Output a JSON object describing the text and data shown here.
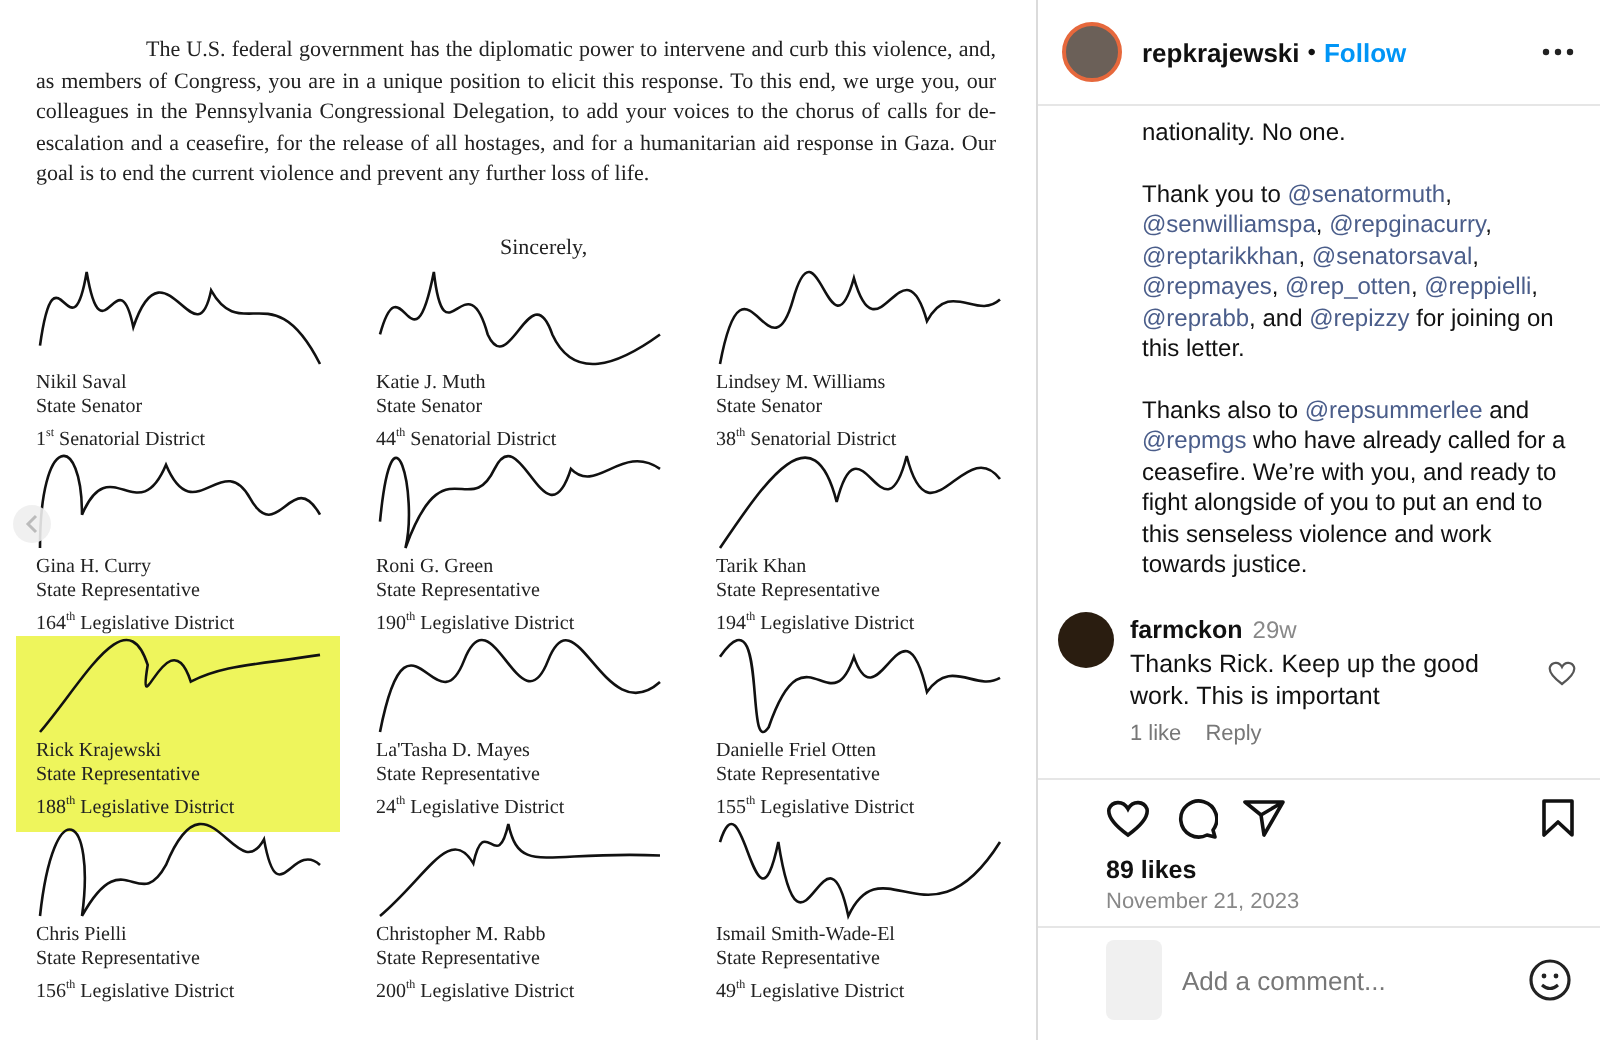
{
  "letter": {
    "paragraph": "The U.S. federal government has the diplomatic power to intervene and curb this violence, and, as members of Congress, you are in a unique position to elicit this response. To this end, we urge you, our colleagues in the Pennsylvania Congressional Delegation, to add your voices to the chorus of calls for de-escalation and a ceasefire, for the release of all hostages, and for a humanitarian aid response in Gaza. Our goal is to end the current violence and prevent any further loss of life.",
    "closing": "Sincerely,",
    "signatories": [
      {
        "name": "Nikil Saval",
        "title": "State Senator",
        "district": "1$^{st}$ Senatorial District",
        "highlighted": false
      },
      {
        "name": "Katie J. Muth",
        "title": "State Senator",
        "district": "44$^{th}$ Senatorial District",
        "highlighted": false
      },
      {
        "name": "Lindsey M. Williams",
        "title": "State Senator",
        "district": "38$^{th}$ Senatorial District",
        "highlighted": false
      },
      {
        "name": "Gina H. Curry",
        "title": "State Representative",
        "district": "164$^{th}$ Legislative District",
        "highlighted": false
      },
      {
        "name": "Roni G. Green",
        "title": "State Representative",
        "district": "190$^{th}$ Legislative District",
        "highlighted": false
      },
      {
        "name": "Tarik Khan",
        "title": "State Representative",
        "district": "194$^{th}$ Legislative District",
        "highlighted": false
      },
      {
        "name": "Rick Krajewski",
        "title": "State Representative",
        "district": "188$^{th}$ Legislative District",
        "highlighted": true
      },
      {
        "name": "La'Tasha D. Mayes",
        "title": "State Representative",
        "district": "24$^{th}$ Legislative District",
        "highlighted": false
      },
      {
        "name": "Danielle Friel Otten",
        "title": "State Representative",
        "district": "155$^{th}$ Legislative District",
        "highlighted": false
      },
      {
        "name": "Chris Pielli",
        "title": "State Representative",
        "district": "156$^{th}$ Legislative District",
        "highlighted": false
      },
      {
        "name": "Christopher M. Rabb",
        "title": "State Representative",
        "district": "200$^{th}$ Legislative District",
        "highlighted": false
      },
      {
        "name": "Ismail Smith-Wade-El",
        "title": "State Representative",
        "district": "49$^{th}$ Legislative District",
        "highlighted": false
      }
    ]
  },
  "post": {
    "username": "repkrajewski",
    "separator": "•",
    "follow": "Follow",
    "caption": [
      [
        {
          "kind": "text",
          "text": "nationality. No one."
        }
      ],
      [
        {
          "kind": "text",
          "text": "Thank you to "
        },
        {
          "kind": "mention",
          "text": "@senatormuth"
        },
        {
          "kind": "text",
          "text": ", "
        },
        {
          "kind": "mention",
          "text": "@senwilliamspa"
        },
        {
          "kind": "text",
          "text": ", "
        },
        {
          "kind": "mention",
          "text": "@repginacurry"
        },
        {
          "kind": "text",
          "text": ", "
        },
        {
          "kind": "mention",
          "text": "@reptarikkhan"
        },
        {
          "kind": "text",
          "text": ", "
        },
        {
          "kind": "mention",
          "text": "@senatorsaval"
        },
        {
          "kind": "text",
          "text": ", "
        },
        {
          "kind": "mention",
          "text": "@repmayes"
        },
        {
          "kind": "text",
          "text": ", "
        },
        {
          "kind": "mention",
          "text": "@rep_otten"
        },
        {
          "kind": "text",
          "text": ", "
        },
        {
          "kind": "mention",
          "text": "@reppielli"
        },
        {
          "kind": "text",
          "text": ", "
        },
        {
          "kind": "mention",
          "text": "@reprabb"
        },
        {
          "kind": "text",
          "text": ", and "
        },
        {
          "kind": "mention",
          "text": "@repizzy"
        },
        {
          "kind": "text",
          "text": " for joining on this letter."
        }
      ],
      [
        {
          "kind": "text",
          "text": "Thanks also to "
        },
        {
          "kind": "mention",
          "text": "@repsummerlee"
        },
        {
          "kind": "text",
          "text": " and "
        },
        {
          "kind": "mention",
          "text": "@repmgs"
        },
        {
          "kind": "text",
          "text": " who have already called for a ceasefire. We’re with you, and ready to fight alongside of you to put an end to this senseless violence and work towards justice."
        }
      ]
    ],
    "comment": {
      "username": "farmckon",
      "time": "29w",
      "text": "Thanks Rick. Keep up the good work. This is important",
      "likes": "1 like",
      "reply": "Reply",
      "liked": false
    },
    "likes": "89 likes",
    "date": "November 21, 2023",
    "saved": false,
    "add_comment": {
      "placeholder": "Add a comment..."
    }
  }
}
